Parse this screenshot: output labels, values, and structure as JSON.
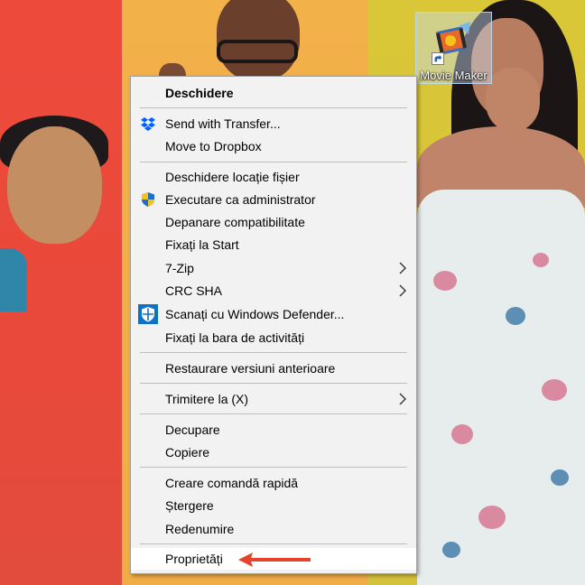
{
  "desktop": {
    "icon": {
      "label": "Movie Maker",
      "icon": "movie-maker-icon",
      "shortcut_overlay": "shortcut-arrow-icon"
    }
  },
  "context_menu": {
    "items": [
      {
        "label": "Deschidere",
        "bold": true
      },
      {
        "label": "Send with Transfer...",
        "icon": "dropbox-icon"
      },
      {
        "label": "Move to Dropbox"
      },
      {
        "label": "Deschidere locație fișier"
      },
      {
        "label": "Executare ca administrator",
        "icon": "uac-shield-icon"
      },
      {
        "label": "Depanare compatibilitate"
      },
      {
        "label": "Fixați la Start"
      },
      {
        "label": "7-Zip",
        "submenu": true
      },
      {
        "label": "CRC SHA",
        "submenu": true
      },
      {
        "label": "Scanați cu Windows Defender...",
        "icon": "windows-defender-icon"
      },
      {
        "label": "Fixați la bara de activități"
      },
      {
        "label": "Restaurare versiuni anterioare"
      },
      {
        "label": "Trimitere la (X)",
        "submenu": true
      },
      {
        "label": "Decupare"
      },
      {
        "label": "Copiere"
      },
      {
        "label": "Creare comandă rapidă"
      },
      {
        "label": "Ștergere"
      },
      {
        "label": "Redenumire"
      },
      {
        "label": "Proprietăți",
        "highlighted": true
      }
    ]
  },
  "annotation": {
    "icon": "red-arrow-icon",
    "color": "#e8412c"
  },
  "colors": {
    "menu_bg": "#f2f2f2",
    "menu_border": "#a0a0a0",
    "highlight_bg": "#ffffff",
    "uac_blue": "#1f6fc8",
    "uac_yellow": "#f4c21a",
    "dropbox_blue": "#0061fe",
    "defender_blue": "#0b72c8"
  }
}
